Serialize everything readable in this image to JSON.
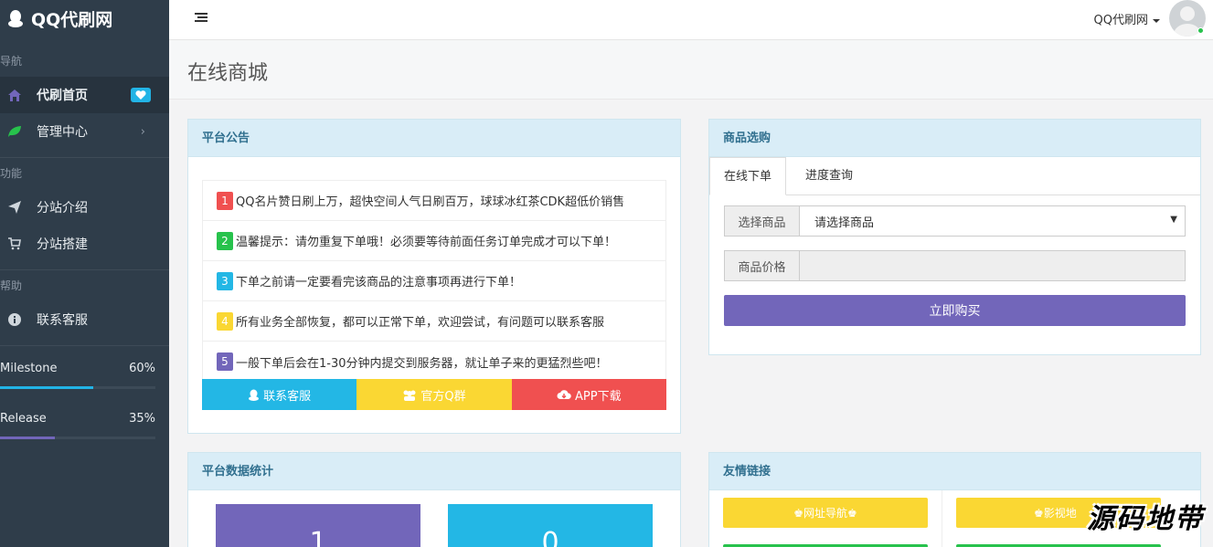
{
  "brand": {
    "title": "QQ代刷网"
  },
  "sidebar": {
    "sections": {
      "nav": "导航",
      "func": "功能",
      "help": "帮助"
    },
    "items": [
      {
        "label": "代刷首页",
        "icon": "home-icon"
      },
      {
        "label": "管理中心",
        "icon": "leaf-icon"
      },
      {
        "label": "分站介绍",
        "icon": "paper-plane-icon"
      },
      {
        "label": "分站搭建",
        "icon": "cart-icon"
      },
      {
        "label": "联系客服",
        "icon": "info-icon"
      }
    ],
    "progress": [
      {
        "label": "Milestone",
        "value": "60%",
        "fraction": 0.6,
        "color": "#22b4e6"
      },
      {
        "label": "Release",
        "value": "35%",
        "fraction": 0.35,
        "color": "#7266ba"
      }
    ]
  },
  "topbar": {
    "user_name": "QQ代刷网"
  },
  "page": {
    "title": "在线商城"
  },
  "announce": {
    "title": "平台公告",
    "items": [
      {
        "num": "1",
        "color": "#f05050",
        "text": "QQ名片赞日刷上万，超快空间人气日刷百万，球球冰红茶CDK超低价销售"
      },
      {
        "num": "2",
        "color": "#27c24c",
        "text": "温馨提示：请勿重复下单哦！必须要等待前面任务订单完成才可以下单！"
      },
      {
        "num": "3",
        "color": "#23b7e5",
        "text": "下单之前请一定要看完该商品的注意事项再进行下单！"
      },
      {
        "num": "4",
        "color": "#fad733",
        "text": "所有业务全部恢复，都可以正常下单，欢迎尝试，有问题可以联系客服"
      },
      {
        "num": "5",
        "color": "#7266ba",
        "text": "一般下单后会在1-30分钟内提交到服务器，就让单子来的更猛烈些吧！"
      }
    ],
    "buttons": [
      {
        "label": "联系客服",
        "color": "#23b7e5",
        "icon": "qq-icon"
      },
      {
        "label": "官方Q群",
        "color": "#fad733",
        "icon": "group-icon"
      },
      {
        "label": "APP下载",
        "color": "#f05050",
        "icon": "cloud-download-icon"
      }
    ]
  },
  "shop": {
    "title": "商品选购",
    "tabs": [
      "在线下单",
      "进度查询"
    ],
    "select_label": "选择商品",
    "select_value": "请选择商品",
    "price_label": "商品价格",
    "price_value": "",
    "buy_label": "立即购买"
  },
  "stats": {
    "title": "平台数据统计",
    "values": [
      "1",
      "0"
    ],
    "colors": [
      "#7266ba",
      "#23b7e5"
    ]
  },
  "links": {
    "title": "友情链接",
    "items": [
      "♚网址导航♚",
      "♚影视地"
    ]
  },
  "watermark": "源码地带"
}
